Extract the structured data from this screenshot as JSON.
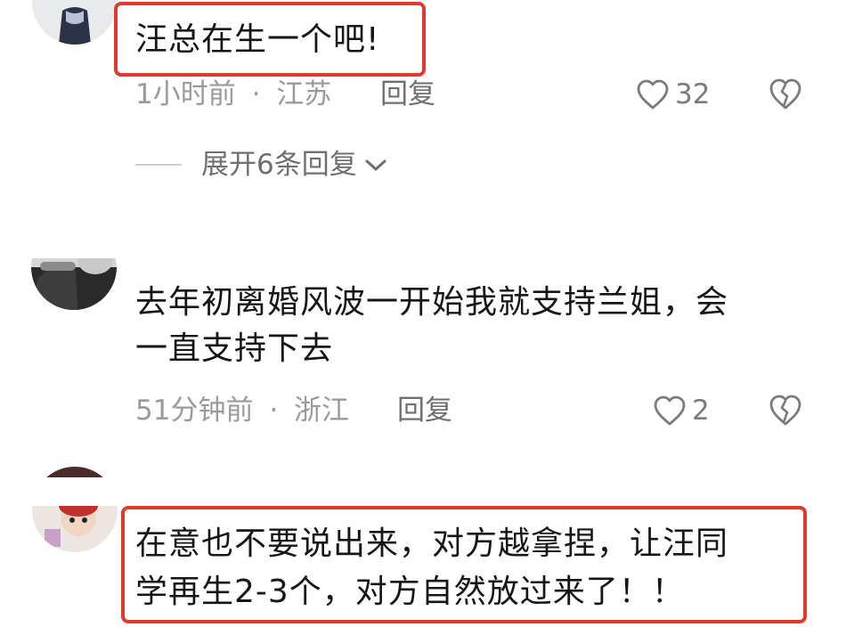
{
  "comments": [
    {
      "text_lines": [
        "汪总在生一个吧!"
      ],
      "time": "1小时前",
      "location": "江苏",
      "reply_label": "回复",
      "likes": "32",
      "expand_label": "展开6条回复"
    },
    {
      "text_lines": [
        "去年初离婚风波一开始我就支持兰姐，会",
        "一直支持下去"
      ],
      "time": "51分钟前",
      "location": "浙江",
      "reply_label": "回复",
      "likes": "2"
    },
    {
      "text_lines": [
        "在意也不要说出来，对方越拿捏，让汪同",
        "学再生2-3个，对方自然放过来了！！"
      ]
    }
  ],
  "meta_separator": "·",
  "colors": {
    "highlight": "#e2392f",
    "text": "#161616",
    "meta": "#9a9a9a"
  },
  "icons": {
    "like": "heart-outline-icon",
    "dislike": "broken-heart-icon",
    "expand": "chevron-down-icon"
  }
}
